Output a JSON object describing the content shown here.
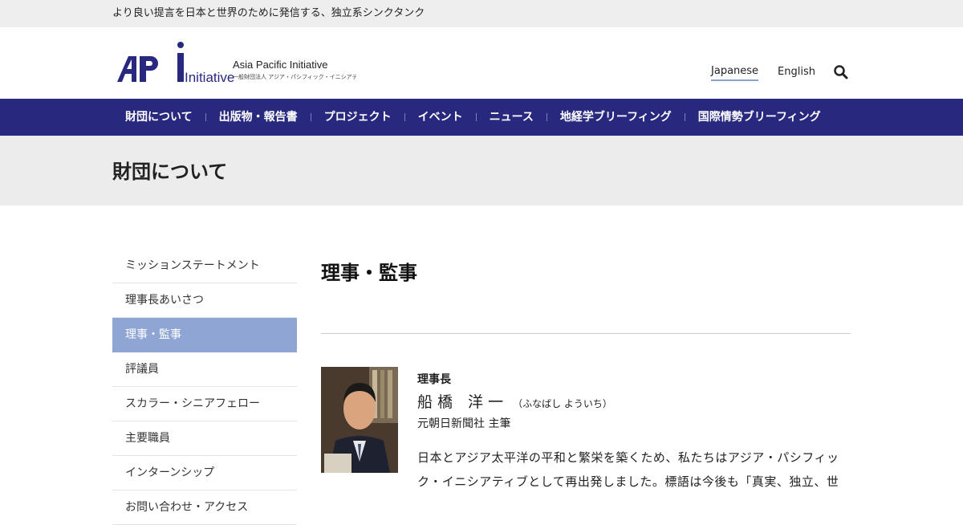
{
  "topbar": {
    "tagline": "より良い提言を日本と世界のために発信する、独立系シンクタンク"
  },
  "header": {
    "logo_mark": "AP",
    "logo_word": "Initiative",
    "logo_name": "Asia Pacific Initiative",
    "logo_sub": "一般財団法人 アジア・パシフィック・イニシアティブ",
    "lang_japanese": "Japanese",
    "lang_english": "English",
    "search_icon": "search-icon"
  },
  "nav": {
    "items": [
      {
        "label": "財団について"
      },
      {
        "label": "出版物・報告書"
      },
      {
        "label": "プロジェクト"
      },
      {
        "label": "イベント"
      },
      {
        "label": "ニュース"
      },
      {
        "label": "地経学ブリーフィング"
      },
      {
        "label": "国際情勢ブリーフィング"
      }
    ]
  },
  "hero": {
    "title": "財団について"
  },
  "sidebar": {
    "items": [
      {
        "label": "ミッションステートメント"
      },
      {
        "label": "理事長あいさつ"
      },
      {
        "label": "理事・監事"
      },
      {
        "label": "評議員"
      },
      {
        "label": "スカラー・シニアフェロー"
      },
      {
        "label": "主要職員"
      },
      {
        "label": "インターンシップ"
      },
      {
        "label": "お問い合わせ・アクセス"
      }
    ],
    "active_index": 2
  },
  "main": {
    "title": "理事・監事",
    "person": {
      "role": "理事長",
      "name": "船 橋　洋 一",
      "kana": "（ふなばし よういち）",
      "affiliation": "元朝日新聞社 主筆",
      "bio": "日本とアジア太平洋の平和と繁栄を築くため、私たちはアジア・パシフィック・イニシアティブとして再出発しました。標語は今後も「真実、独立、世"
    }
  },
  "colors": {
    "nav_bg": "#28287f",
    "active_item": "#8fa6d4",
    "topbar_bg": "#eeeeee",
    "hero_bg": "#ececec"
  }
}
